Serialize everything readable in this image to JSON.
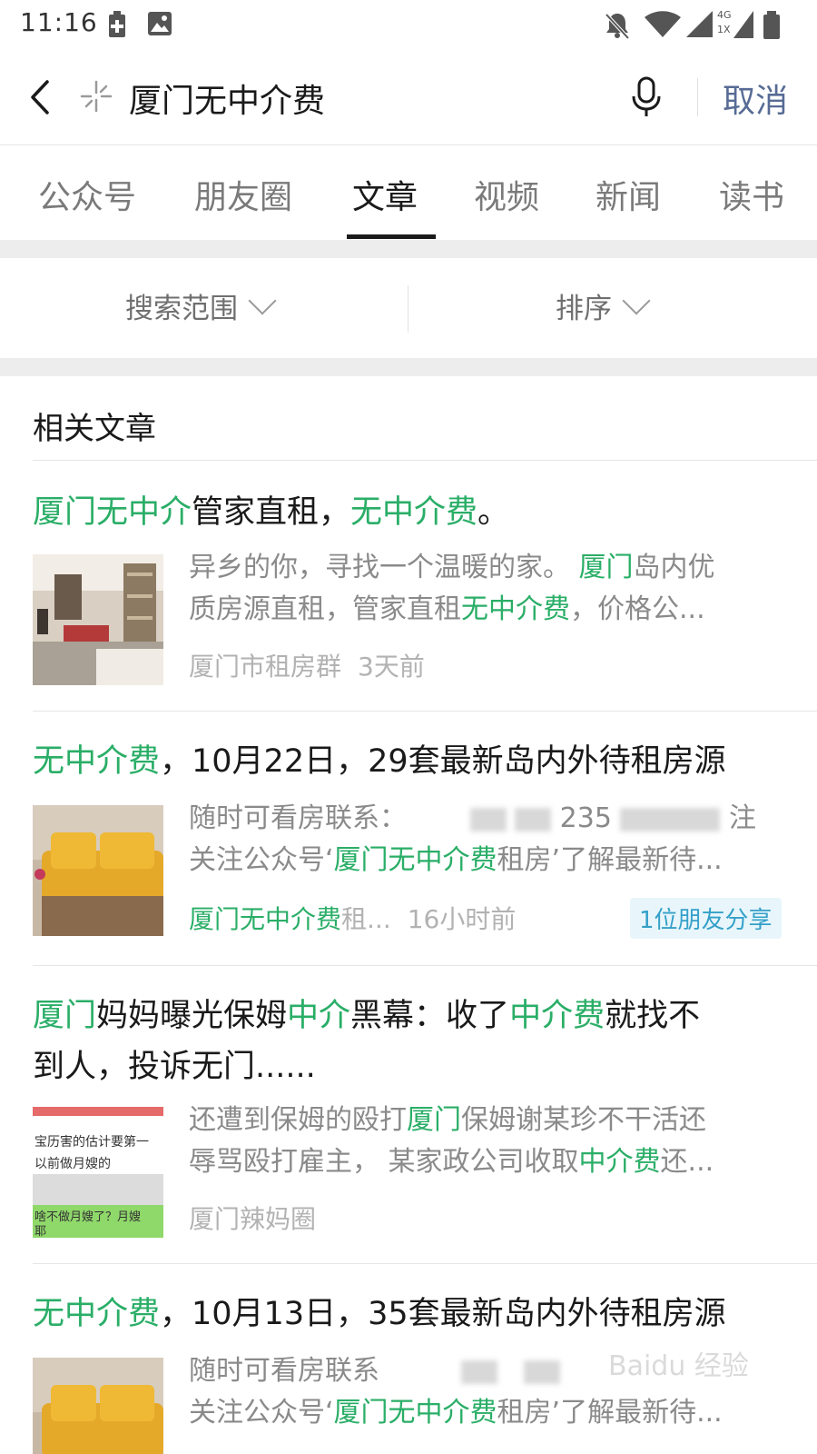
{
  "status_bar": {
    "time": "11:16",
    "icons": [
      "battery-saver-icon",
      "image-icon",
      "do-not-disturb-icon",
      "wifi-icon",
      "signal-icon",
      "network-4g-icon",
      "battery-icon"
    ],
    "network_label_top": "4G",
    "network_label_bottom": "1X"
  },
  "search": {
    "query": "厦门无中介费",
    "cancel_label": "取消",
    "icons": [
      "back-arrow-icon",
      "sparkle-icon",
      "microphone-icon"
    ]
  },
  "tabs": [
    {
      "label": "公众号",
      "active": false
    },
    {
      "label": "朋友圈",
      "active": false
    },
    {
      "label": "文章",
      "active": true
    },
    {
      "label": "视频",
      "active": false
    },
    {
      "label": "新闻",
      "active": false
    },
    {
      "label": "读书",
      "active": false
    }
  ],
  "filters": {
    "scope_label": "搜索范围",
    "sort_label": "排序"
  },
  "section_title": "相关文章",
  "articles": [
    {
      "title_parts": [
        {
          "text": "厦门无中介",
          "hl": true
        },
        {
          "text": "管家直租，",
          "hl": false
        },
        {
          "text": "无中介费",
          "hl": true
        },
        {
          "text": "。",
          "hl": false
        }
      ],
      "snippet_line1": [
        {
          "text": "异乡的你，寻找一个温暖的家。 ",
          "hl": false
        },
        {
          "text": "厦门",
          "hl": true
        },
        {
          "text": "岛内优",
          "hl": false
        }
      ],
      "snippet_line2": [
        {
          "text": "质房源直租，管家直租",
          "hl": false
        },
        {
          "text": "无中介费",
          "hl": true
        },
        {
          "text": "，价格公...",
          "hl": false
        }
      ],
      "source": "厦门市租房群",
      "time": "3天前"
    },
    {
      "title_parts": [
        {
          "text": "无中介费",
          "hl": true
        },
        {
          "text": "，10月22日，29套最新岛内外待租房源",
          "hl": false
        }
      ],
      "snippet_line1_prefix": "随时可看房联系：",
      "snippet_line1_mid": "235",
      "snippet_line1_suffix": "注",
      "snippet_line2": [
        {
          "text": "关注公众号‘",
          "hl": false
        },
        {
          "text": "厦门无中介费",
          "hl": true
        },
        {
          "text": "租房’了解最新待...",
          "hl": false
        }
      ],
      "source_parts": [
        {
          "text": "厦门无中介费",
          "hl": true
        },
        {
          "text": "租...",
          "hl": false
        }
      ],
      "time": "16小时前",
      "share_badge": "1位朋友分享"
    },
    {
      "title_line1": [
        {
          "text": "厦门",
          "hl": true
        },
        {
          "text": "妈妈曝光保姆",
          "hl": false
        },
        {
          "text": "中介",
          "hl": true
        },
        {
          "text": "黑幕：收了",
          "hl": false
        },
        {
          "text": "中介费",
          "hl": true
        },
        {
          "text": "就找不",
          "hl": false
        }
      ],
      "title_line2": "到人，投诉无门......",
      "thumb_text_1": "宝历害的估计要第一",
      "thumb_text_2": "以前做月嫂的",
      "thumb_text_3": "啥不做月嫂了？月嫂",
      "thumb_text_4": "耶",
      "snippet_line1": [
        {
          "text": "还遭到保姆的殴打",
          "hl": false
        },
        {
          "text": "厦门",
          "hl": true
        },
        {
          "text": "保姆谢某珍不干活还",
          "hl": false
        }
      ],
      "snippet_line2": [
        {
          "text": "辱骂殴打雇主， 某家政公司收取",
          "hl": false
        },
        {
          "text": "中介费",
          "hl": true
        },
        {
          "text": "还...",
          "hl": false
        }
      ],
      "source": "厦门辣妈圈"
    },
    {
      "title_parts": [
        {
          "text": "无中介费",
          "hl": true
        },
        {
          "text": "，10月13日，35套最新岛内外待租房源",
          "hl": false
        }
      ],
      "snippet_line1_prefix": "随时可看房联系",
      "snippet_line2": [
        {
          "text": "关注公众号‘",
          "hl": false
        },
        {
          "text": "厦门无中介费",
          "hl": true
        },
        {
          "text": "租房’了解最新待...",
          "hl": false
        }
      ]
    }
  ],
  "watermark": "Baidu 经验",
  "colors": {
    "highlight": "#2aae67",
    "cancel": "#576b95",
    "secondary_text": "#8a8a8a",
    "meta_text": "#b2b2b2",
    "separator": "#ededed",
    "share_badge_bg": "#e8f6fb",
    "share_badge_text": "#35a0c9"
  }
}
